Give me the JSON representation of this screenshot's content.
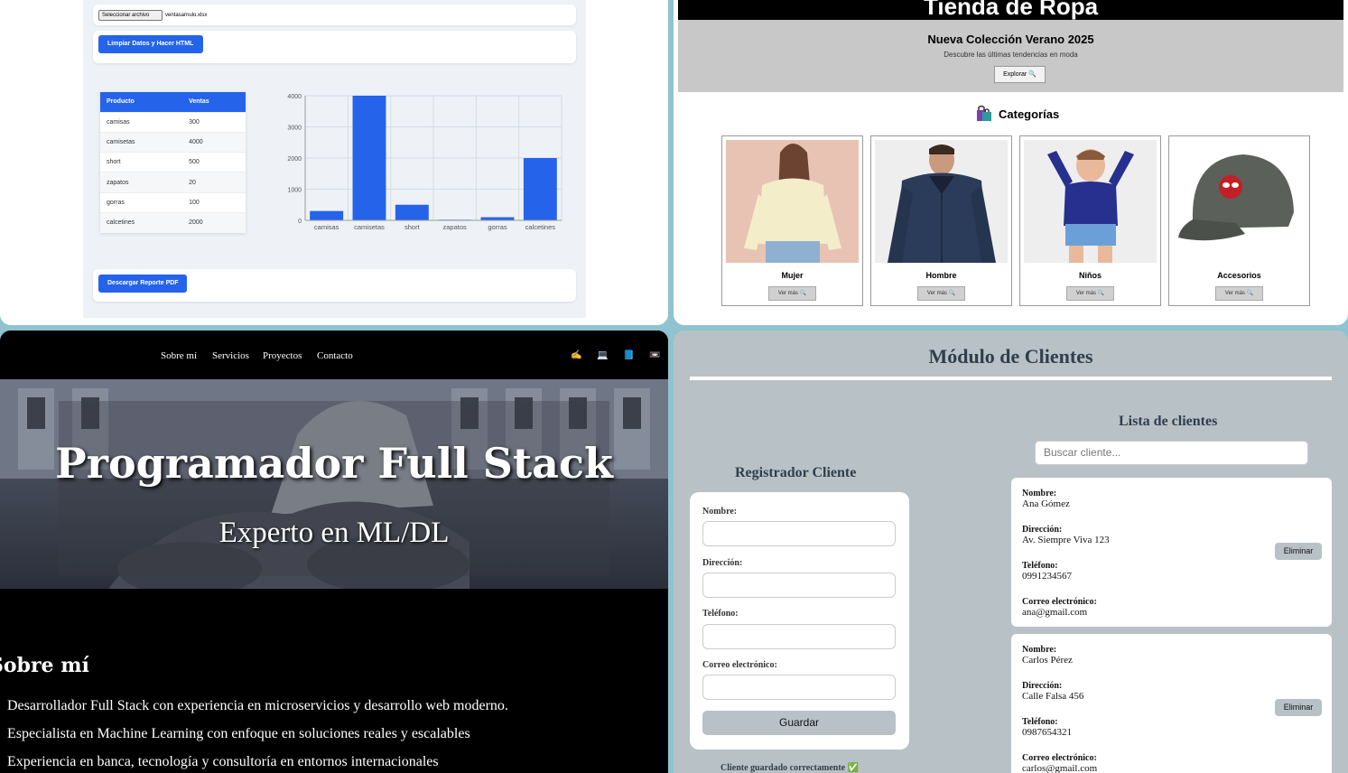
{
  "report_app": {
    "file_button": "Seleccionar archivo",
    "file_name": "ventasarnulo.xlsx",
    "clean_button": "Limpiar Datos y Hacer HTML",
    "table_headers": [
      "Producto",
      "Ventas"
    ],
    "table_rows": [
      [
        "camisas",
        "300"
      ],
      [
        "camisetas",
        "4000"
      ],
      [
        "short",
        "500"
      ],
      [
        "zapatos",
        "20"
      ],
      [
        "gorras",
        "100"
      ],
      [
        "calcetines",
        "2000"
      ]
    ],
    "download_button": "Descargar Reporte PDF",
    "accent_color": "#2563eb"
  },
  "chart_data": {
    "type": "bar",
    "categories": [
      "camisas",
      "camisetas",
      "short",
      "zapatos",
      "gorras",
      "calcetines"
    ],
    "values": [
      300,
      4000,
      500,
      20,
      100,
      2000
    ],
    "ylim": [
      0,
      4000
    ],
    "yticks": [
      0,
      1000,
      2000,
      3000,
      4000
    ],
    "grid": true,
    "color": "#2563eb"
  },
  "store": {
    "title": "Tienda de Ropa",
    "hero_title": "Nueva Colección Verano 2025",
    "hero_subtitle": "Descubre las últimas tendencias en moda",
    "explore_button": "Explorar 🔍",
    "categories_heading": "Categorías",
    "categories_icon": "shopping-bags-icon",
    "categories": [
      {
        "name": "Mujer",
        "button": "Ver más 🔍"
      },
      {
        "name": "Hombre",
        "button": "Ver más 🔍"
      },
      {
        "name": "Niños",
        "button": "Ver más 🔍"
      },
      {
        "name": "Accesorios",
        "button": "Ver más 🔍"
      }
    ]
  },
  "portfolio": {
    "nav": [
      "Sobre mí",
      "Servicios",
      "Proyectos",
      "Contacto"
    ],
    "nav_icons": [
      "✍",
      "💻",
      "📘",
      "📼"
    ],
    "hero_title": "Programador Full Stack",
    "hero_subtitle": "Experto en ML/DL",
    "about_heading": "Sobre mí",
    "about_lines": [
      "Desarrollador Full Stack con experiencia en microservicios y desarrollo web moderno.",
      "Especialista en Machine Learning con enfoque en soluciones reales y escalables",
      "Experiencia en banca, tecnología y consultoría en entornos internacionales"
    ]
  },
  "clients": {
    "title": "Módulo de Clientes",
    "form_heading": "Registrador Cliente",
    "form_labels": [
      "Nombre:",
      "Dirección:",
      "Teléfono:",
      "Correo electrónico:"
    ],
    "save_button": "Guardar",
    "saved_message": "Cliente guardado correctamente ✅",
    "list_heading": "Lista de clientes",
    "search_placeholder": "Buscar cliente...",
    "delete_button": "Eliminar",
    "list": [
      {
        "Nombre:": "Ana Gómez",
        "Dirección:": "Av. Siempre Viva 123",
        "Teléfono:": "0991234567",
        "Correo electrónico:": "ana@gmail.com"
      },
      {
        "Nombre:": "Carlos Pérez",
        "Dirección:": "Calle Falsa 456",
        "Teléfono:": "0987654321",
        "Correo electrónico:": "carlos@gmail.com"
      }
    ]
  }
}
